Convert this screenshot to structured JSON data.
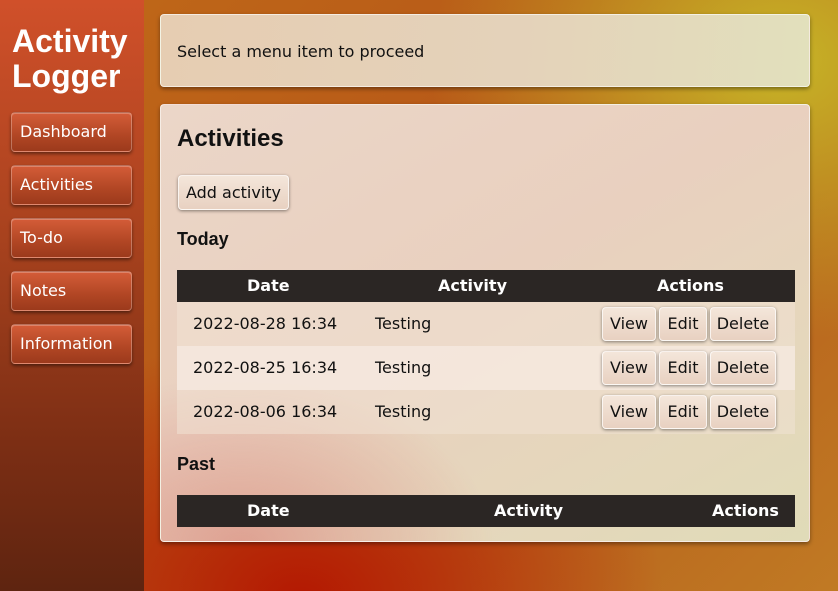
{
  "app": {
    "title_line1": "Activity",
    "title_line2": "Logger"
  },
  "sidebar": {
    "items": [
      {
        "label": "Dashboard"
      },
      {
        "label": "Activities"
      },
      {
        "label": "To-do"
      },
      {
        "label": "Notes"
      },
      {
        "label": "Information"
      }
    ]
  },
  "notice": {
    "text": "Select a menu item to proceed"
  },
  "main": {
    "heading": "Activities",
    "add_button": "Add activity",
    "today": {
      "heading": "Today",
      "columns": [
        "Date",
        "Activity",
        "Actions"
      ],
      "rows": [
        {
          "date": "2022-08-28 16:34",
          "activity": "Testing",
          "view": "View",
          "edit": "Edit",
          "delete": "Delete"
        },
        {
          "date": "2022-08-25 16:34",
          "activity": "Testing",
          "view": "View",
          "edit": "Edit",
          "delete": "Delete"
        },
        {
          "date": "2022-08-06 16:34",
          "activity": "Testing",
          "view": "View",
          "edit": "Edit",
          "delete": "Delete"
        }
      ]
    },
    "past": {
      "heading": "Past",
      "columns": [
        "Date",
        "Activity",
        "Actions"
      ],
      "rows": []
    }
  }
}
